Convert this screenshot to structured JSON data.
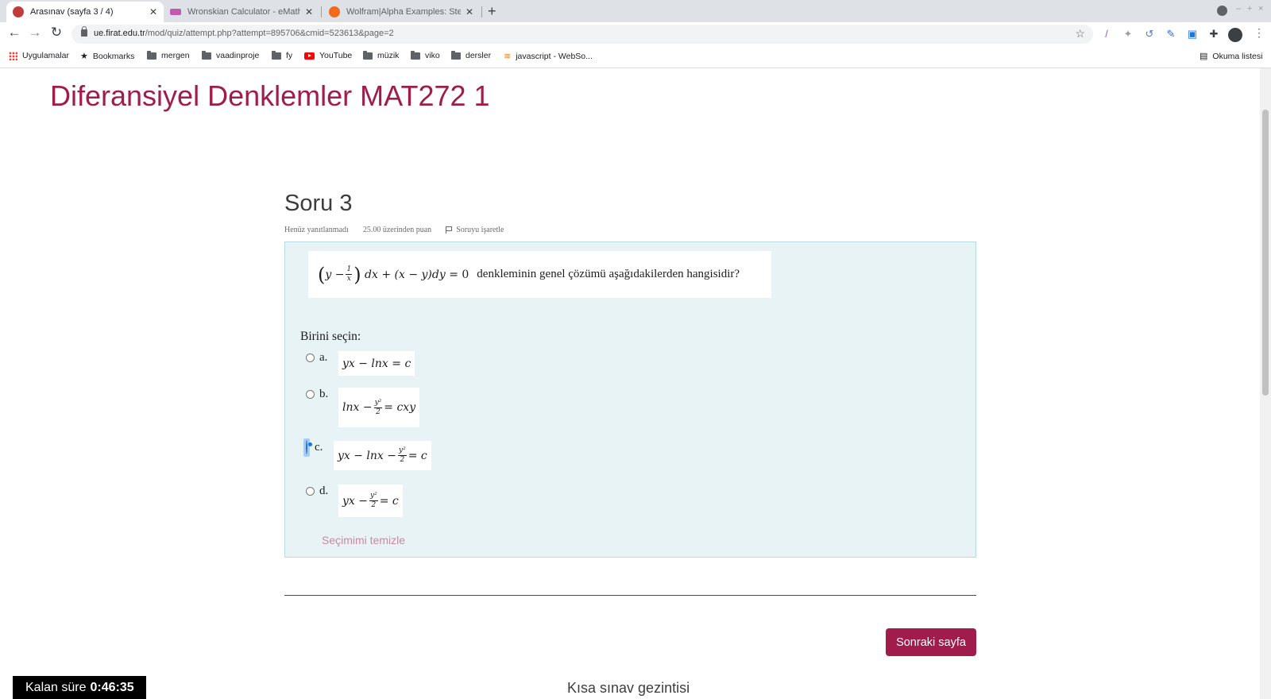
{
  "browser": {
    "tabs": [
      {
        "title": "Arasınav (sayfa 3 / 4)",
        "active": true
      },
      {
        "title": "Wronskian Calculator - eMathHe",
        "active": false
      },
      {
        "title": "Wolfram|Alpha Examples: Step-b",
        "active": false
      }
    ],
    "url_domain": "ue.firat.edu.tr",
    "url_path": "/mod/quiz/attempt.php?attempt=895706&cmid=523613&page=2",
    "bookmarks": [
      "Uygulamalar",
      "Bookmarks",
      "mergen",
      "vaadinproje",
      "fy",
      "YouTube",
      "müzik",
      "viko",
      "dersler",
      "javascript - WebSo..."
    ],
    "reading_list": "Okuma listesi"
  },
  "page": {
    "course_title": "Diferansiyel Denklemler MAT272 1",
    "question": {
      "title": "Soru 3",
      "status": "Henüz yanıtlanmadı",
      "points": "25.00 üzerinden puan",
      "flag_label": "Soruyu işaretle",
      "text": "denkleminin genel çözümü aşağıdakilerden hangisidir?",
      "prompt": "Birini seçin:",
      "options": [
        {
          "letter": "a.",
          "selected": false
        },
        {
          "letter": "b.",
          "selected": false
        },
        {
          "letter": "c.",
          "selected": true
        },
        {
          "letter": "d.",
          "selected": false
        }
      ],
      "clear_label": "Seçimimi temizle"
    },
    "next_button": "Sonraki sayfa",
    "nav_title": "Kısa sınav gezintisi",
    "timer_label": "Kalan süre",
    "timer_value": "0:46:35"
  },
  "colors": {
    "brand": "#a01c4b",
    "formulation_bg": "#e7f3f5",
    "radio_selected": "#1a73e8"
  }
}
